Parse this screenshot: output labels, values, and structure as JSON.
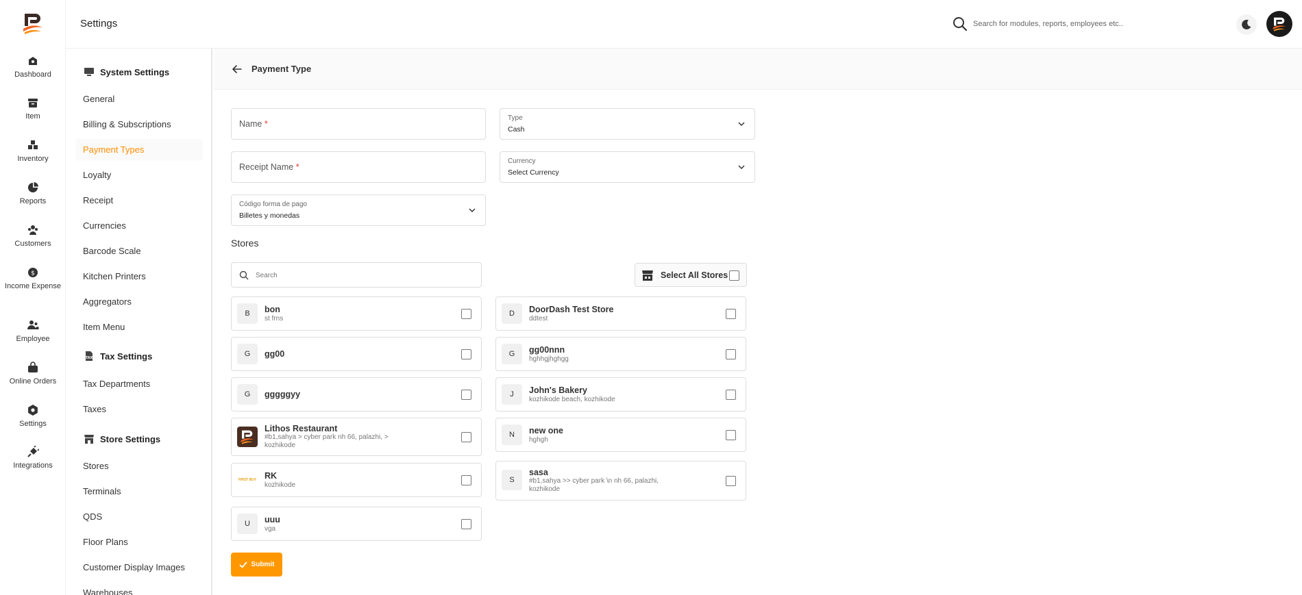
{
  "app": {
    "page_title": "Settings"
  },
  "topbar": {
    "search_placeholder": "Search for modules, reports, employees etc.."
  },
  "rail": {
    "items": [
      {
        "label": "Dashboard"
      },
      {
        "label": "Item"
      },
      {
        "label": "Inventory"
      },
      {
        "label": "Reports"
      },
      {
        "label": "Customers"
      },
      {
        "label": "Income Expense"
      },
      {
        "label": "Employee"
      },
      {
        "label": "Online Orders"
      },
      {
        "label": "Settings"
      },
      {
        "label": "Integrations"
      }
    ]
  },
  "sidebar": {
    "system_title": "System Settings",
    "system_items": [
      "General",
      "Billing & Subscriptions",
      "Payment Types",
      "Loyalty",
      "Receipt",
      "Currencies",
      "Barcode Scale",
      "Kitchen Printers",
      "Aggregators",
      "Item Menu"
    ],
    "tax_title": "Tax Settings",
    "tax_items": [
      "Tax Departments",
      "Taxes"
    ],
    "store_title": "Store Settings",
    "store_items": [
      "Stores",
      "Terminals",
      "QDS",
      "Floor Plans",
      "Customer Display Images",
      "Warehouses"
    ],
    "active": "Payment Types"
  },
  "form": {
    "header_title": "Payment Type",
    "name_placeholder": "Name",
    "receipt_name_placeholder": "Receipt Name",
    "required_mark": "*",
    "type_label": "Type",
    "type_value": "Cash",
    "currency_label": "Currency",
    "currency_value": "Select Currency",
    "codigo_label": "Código forma de pago",
    "codigo_value": "Billetes y monedas",
    "stores_title": "Stores",
    "store_search_placeholder": "Search",
    "select_all_label": "Select All Stores",
    "submit_label": "Submit"
  },
  "stores": {
    "left": [
      {
        "badge": "B",
        "name": "bon",
        "address": "st frns"
      },
      {
        "badge": "G",
        "name": "gg00",
        "address": ""
      },
      {
        "badge": "G",
        "name": "gggggyy",
        "address": ""
      },
      {
        "badge": "",
        "name": "Lithos Restaurant",
        "address": "#b1,sahya > cyber park nh 66, palazhi, > kozhikode"
      },
      {
        "badge": "",
        "name": "RK",
        "address": "kozhikode"
      },
      {
        "badge": "U",
        "name": "uuu",
        "address": "vga"
      }
    ],
    "right": [
      {
        "badge": "D",
        "name": "DoorDash Test Store",
        "address": "ddtest"
      },
      {
        "badge": "G",
        "name": "gg00nnn",
        "address": "hghhgjhghgg"
      },
      {
        "badge": "J",
        "name": "John's Bakery",
        "address": "kozhikode beach, kozhikode"
      },
      {
        "badge": "N",
        "name": "new one",
        "address": "hghgh"
      },
      {
        "badge": "S",
        "name": "sasa",
        "address": "#b1,sahya >> cyber park \\n nh 66, palazhi, kozhikode"
      }
    ],
    "rk_logo_text": "FIRST BUY"
  },
  "colors": {
    "accent": "#ff9800",
    "active_text": "#ff8c00"
  }
}
